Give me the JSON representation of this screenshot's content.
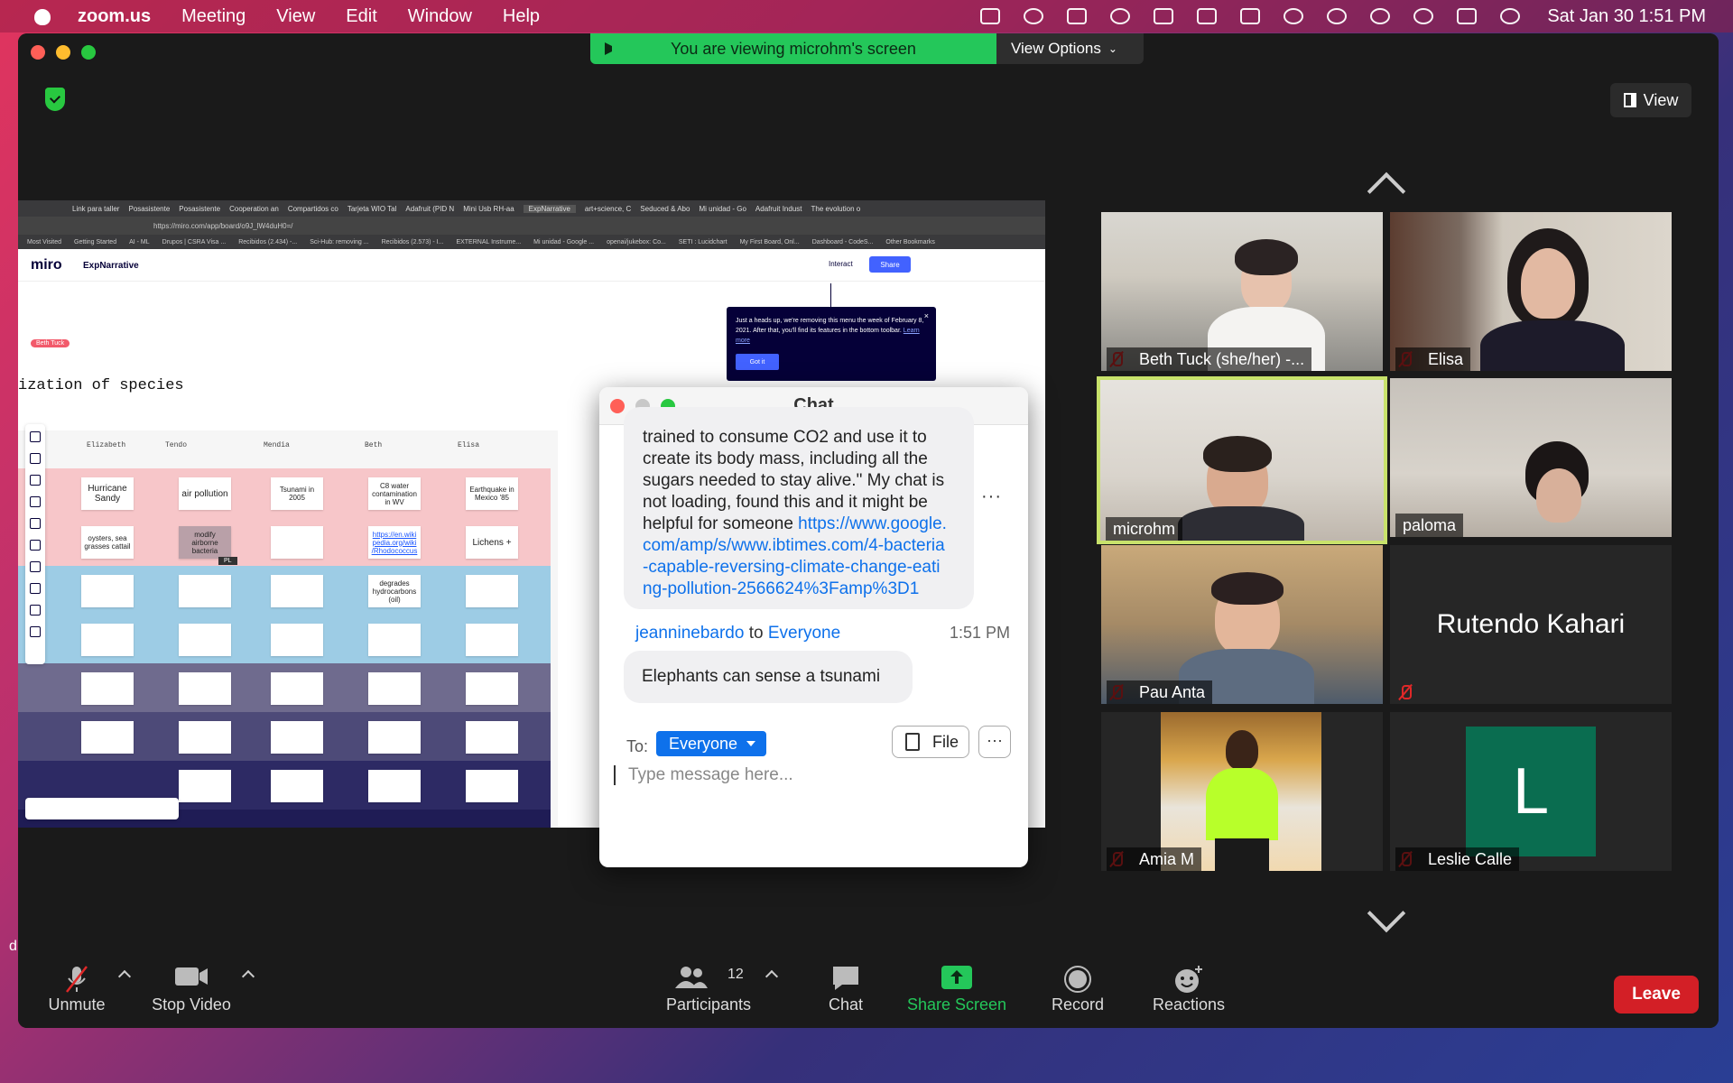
{
  "menubar": {
    "app": "zoom.us",
    "items": [
      "Meeting",
      "View",
      "Edit",
      "Window",
      "Help"
    ],
    "clock": "Sat Jan 30  1:51 PM"
  },
  "banner": {
    "text": "You are viewing microhm's screen",
    "view_options": "View Options"
  },
  "view_button": "View",
  "shared_screen": {
    "browser_tabs": [
      "Link para taller",
      "Posasistente",
      "Posasistente",
      "Cooperation an",
      "Compartidos co",
      "Tarjeta WIO Tal",
      "Adafruit (PID N",
      "Mini Usb RH-aa",
      "ExpNarrative",
      "art+science, C",
      "Seduced & Abo",
      "Mi unidad - Go",
      "Adafruit Indust",
      "The evolution o"
    ],
    "url": "https://miro.com/app/board/o9J_lW4duH0=/",
    "bookmarks": [
      "Most Visited",
      "Getting Started",
      "AI - ML",
      "Drupos | CSRA Visa ...",
      "Recibidos (2.434) -...",
      "Sci-Hub: removing ...",
      "Recibidos (2.573) - I...",
      "EXTERNAL Instrume...",
      "Mi unidad - Google ...",
      "openai/jukebox: Co...",
      "SETI : Lucidchart",
      "My First Board, Onl...",
      "Dashboard - CodeS...",
      "Other Bookmarks"
    ],
    "miro_logo": "miro",
    "board_name": "ExpNarrative",
    "interact": "Interact",
    "share": "Share",
    "cursor_tag": "Beth Tuck",
    "heading": "ization of species",
    "tooltip": {
      "text": "Just a heads up, we're removing this menu the week of February 8, 2021. After that, you'll find its features in the bottom toolbar.",
      "link": "Learn more",
      "button": "Got it",
      "close": "×"
    },
    "columns": [
      "Elizabeth",
      "Tendo",
      "Mendia",
      "Beth",
      "Elisa"
    ],
    "row1": [
      "Hurricane Sandy",
      "air pollution",
      "Tsunami in 2005",
      "C8 water contamination in WV",
      "Earthquake in Mexico '85"
    ],
    "row2": [
      "oysters, sea grasses cattail",
      "modify airborne bacteria",
      "",
      "https://en.wiki pedia.org/wiki /Rhodococcus",
      "Lichens +"
    ],
    "row3_beth": "degrades hydrocarbons (oil)",
    "cursor_pl": "PL"
  },
  "chat": {
    "title": "Chat",
    "message1": {
      "text": "trained to consume CO2 and use it to create its body mass, including all the sugars needed to stay alive.\" My chat is not loading, found this and it might be helpful for someone",
      "link": "https://www.google.com/amp/s/www.ibtimes.com/4-bacteria-capable-reversing-climate-change-eating-pollution-2566624%3Famp%3D1"
    },
    "more": "···",
    "sender": "jeanninebardo",
    "to_word": "to",
    "recipient": "Everyone",
    "time": "1:51 PM",
    "message2": "Elephants can sense a tsunami",
    "to_label": "To:",
    "to_select": "Everyone",
    "file_button": "File",
    "more_button": "···",
    "placeholder": "Type message here..."
  },
  "participants": [
    {
      "name": "Beth Tuck (she/her) -...",
      "muted": true
    },
    {
      "name": "Elisa",
      "muted": true
    },
    {
      "name": "microhm",
      "muted": false,
      "active": true
    },
    {
      "name": "paloma",
      "muted": false
    },
    {
      "name": "Pau Anta",
      "muted": true
    },
    {
      "name": "Rutendo Kahari",
      "muted": true
    },
    {
      "name": "Amia M",
      "muted": true
    },
    {
      "name": "Leslie Calle",
      "muted": true,
      "initial": "L"
    }
  ],
  "controls": {
    "unmute": "Unmute",
    "stop_video": "Stop Video",
    "participants": "Participants",
    "participants_count": "12",
    "chat": "Chat",
    "share_screen": "Share Screen",
    "record": "Record",
    "reactions": "Reactions",
    "leave": "Leave"
  },
  "desktop_char": "d",
  "colors": {
    "zoom_blue": "#0e71eb",
    "share_green": "#24c75a",
    "leave_red": "#d31f26",
    "active_speaker": "#c8e26b",
    "miro_blue": "#4262ff"
  }
}
